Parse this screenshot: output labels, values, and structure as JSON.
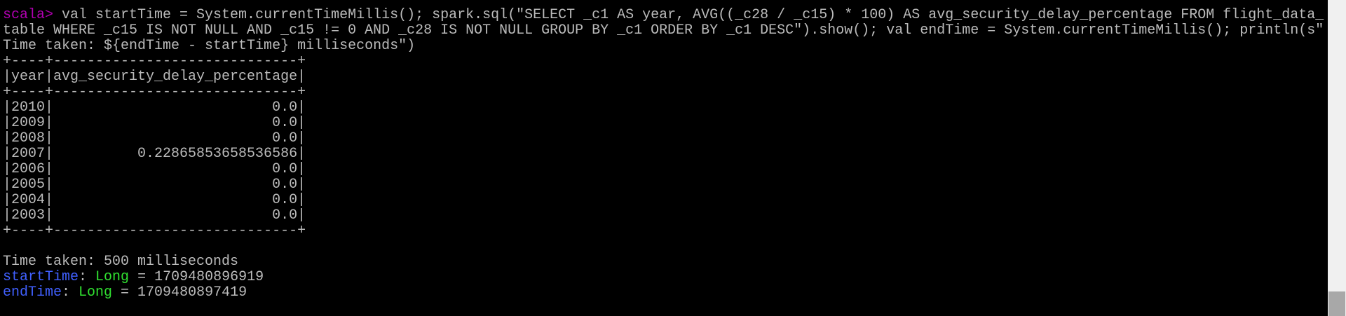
{
  "terminal": {
    "prompt": "scala>",
    "command_lines": [
      " val startTime = System.currentTimeMillis(); spark.sql(\"SELECT _c1 AS year, AVG((_c28 / _c15) * 100) AS avg_security_delay_percentage FROM flight_data_",
      "table WHERE _c15 IS NOT NULL AND _c15 != 0 AND _c28 IS NOT NULL GROUP BY _c1 ORDER BY _c1 DESC\").show(); val endTime = System.currentTimeMillis(); println(s\"",
      "Time taken: ${endTime - startTime} milliseconds\")"
    ],
    "table": {
      "border": "+----+-----------------------------+",
      "header": "|year|avg_security_delay_percentage|",
      "rows": [
        "|2010|                          0.0|",
        "|2009|                          0.0|",
        "|2008|                          0.0|",
        "|2007|          0.22865853658536586|",
        "|2006|                          0.0|",
        "|2005|                          0.0|",
        "|2004|                          0.0|",
        "|2003|                          0.0|"
      ]
    },
    "time_taken": "Time taken: 500 milliseconds",
    "results": [
      {
        "name": "startTime",
        "sep": ": ",
        "type": "Long",
        "value": " = 1709480896919"
      },
      {
        "name": "endTime",
        "sep": ": ",
        "type": "Long",
        "value": " = 1709480897419"
      }
    ]
  },
  "colors": {
    "background": "#000000",
    "text": "#bbbbbb",
    "prompt": "#b000b0",
    "name": "#4060ff",
    "type": "#30e030"
  }
}
